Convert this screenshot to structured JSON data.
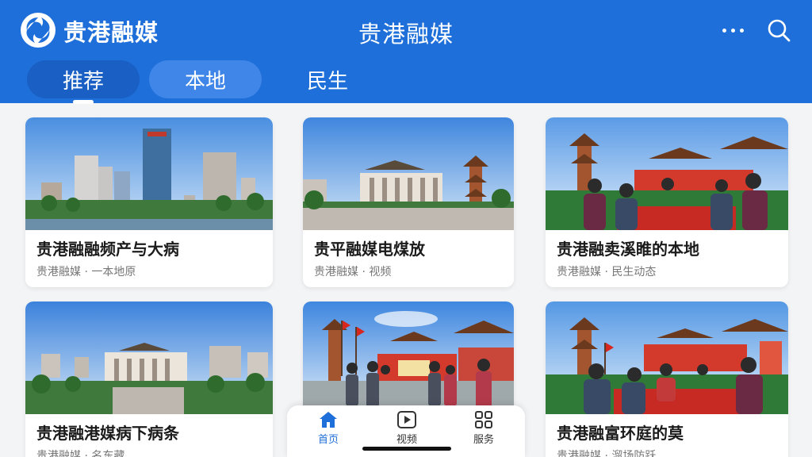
{
  "header": {
    "app_name": "贵港融媒",
    "page_title": "贵港融媒",
    "more_icon": "more-horizontal-icon",
    "search_icon": "search-icon",
    "accent_color": "#1e6fd9"
  },
  "tabs": [
    {
      "label": "推荐",
      "active": true
    },
    {
      "label": "本地",
      "active": false
    },
    {
      "label": "民生",
      "active": false
    }
  ],
  "cards": [
    {
      "title": "贵港融融频产与大病",
      "meta": "贵港融媒 · 一本地原",
      "image": "city-skyline"
    },
    {
      "title": "贵平融媒电煤放",
      "meta": "贵港融媒 · 视频",
      "image": "museum-and-pagoda"
    },
    {
      "title": "贵港融卖溪睢的本地",
      "meta": "贵港融媒 · 民生动态",
      "image": "market-gathering"
    },
    {
      "title": "贵港融港媒病下病条",
      "meta": "贵港融媒 · 名东藏",
      "image": "government-building"
    },
    {
      "title": "",
      "meta": "",
      "image": "festival-crowd"
    },
    {
      "title": "贵港融富环庭的莫",
      "meta": "贵港融媒 · 溜场防跃",
      "image": "market-gathering-2"
    }
  ],
  "bottom_nav": [
    {
      "label": "首页",
      "icon": "home-icon",
      "active": true
    },
    {
      "label": "视频",
      "icon": "play-icon",
      "active": false
    },
    {
      "label": "服务",
      "icon": "grid-icon",
      "active": false
    }
  ]
}
